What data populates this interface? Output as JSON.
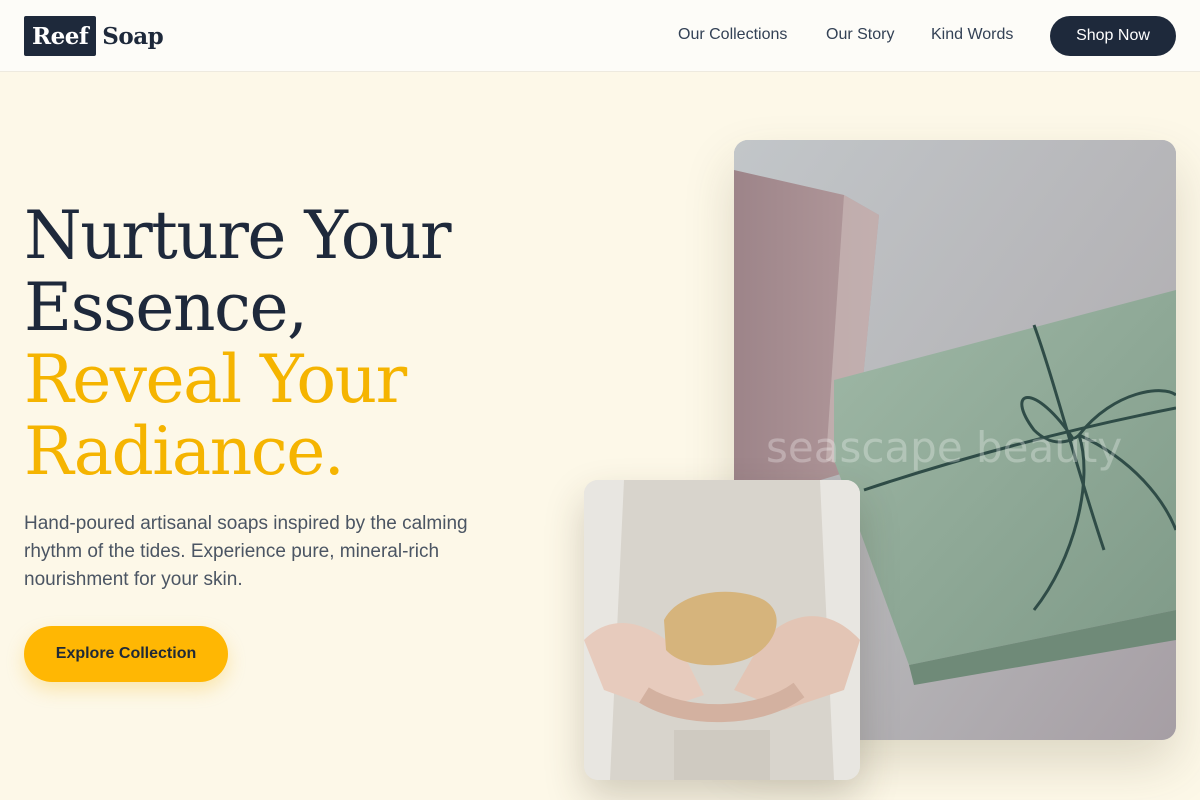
{
  "brand": {
    "logo_box_text": "Reef",
    "logo_text": "Soap"
  },
  "nav": {
    "links": [
      {
        "label": "Our Collections"
      },
      {
        "label": "Our Story"
      },
      {
        "label": "Kind Words"
      }
    ],
    "cta_label": "Shop Now"
  },
  "hero": {
    "headline_dark": [
      "Nurture Your",
      "Essence,"
    ],
    "headline_gold": [
      "Reveal Your",
      "Radiance."
    ],
    "subcopy_lines": [
      "Hand-poured artisanal soaps inspired by the calming",
      "rhythm of the tides. Experience pure, mineral-rich",
      "nourishment for your skin."
    ],
    "cta_label": "Explore Collection"
  },
  "images": {
    "main_watermark": "seascape beauty",
    "main_icon": "soap-bars-photo",
    "small_icon": "hands-holding-soap-photo"
  },
  "colors": {
    "background": "#fdf8e8",
    "navy": "#1e293b",
    "gold": "#f5b400",
    "button_gold": "#ffb703"
  }
}
